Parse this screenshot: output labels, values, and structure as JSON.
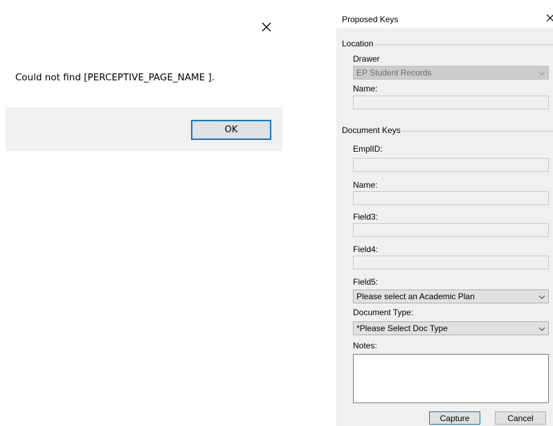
{
  "message_dialog": {
    "message": "Could not find [PERCEPTIVE_PAGE_NAME ].",
    "ok_label": "OK"
  },
  "proposed_keys": {
    "title": "Proposed Keys",
    "location": {
      "group_label": "Location",
      "drawer_label": "Drawer",
      "drawer_value": "EP Student Records",
      "name_label": "Name:",
      "name_value": ""
    },
    "document_keys": {
      "group_label": "Document Keys",
      "emplid_label": "EmplID:",
      "emplid_value": "",
      "name_label": "Name:",
      "name_value": "",
      "field3_label": "Field3:",
      "field3_value": "",
      "field4_label": "Field4:",
      "field4_value": "",
      "field5_label": "Field5:",
      "field5_value": "Please select an Academic  Plan",
      "doc_type_label": "Document Type:",
      "doc_type_value": "*Please Select Doc Type",
      "notes_label": "Notes:",
      "notes_value": ""
    },
    "buttons": {
      "capture": "Capture",
      "cancel": "Cancel"
    }
  },
  "icons": {
    "close": "close-icon",
    "dropdown": "chevron-down-icon"
  },
  "colors": {
    "accent": "#0078d7",
    "dialog_background": "#f0f0f0",
    "button_face": "#e1e1e1"
  }
}
